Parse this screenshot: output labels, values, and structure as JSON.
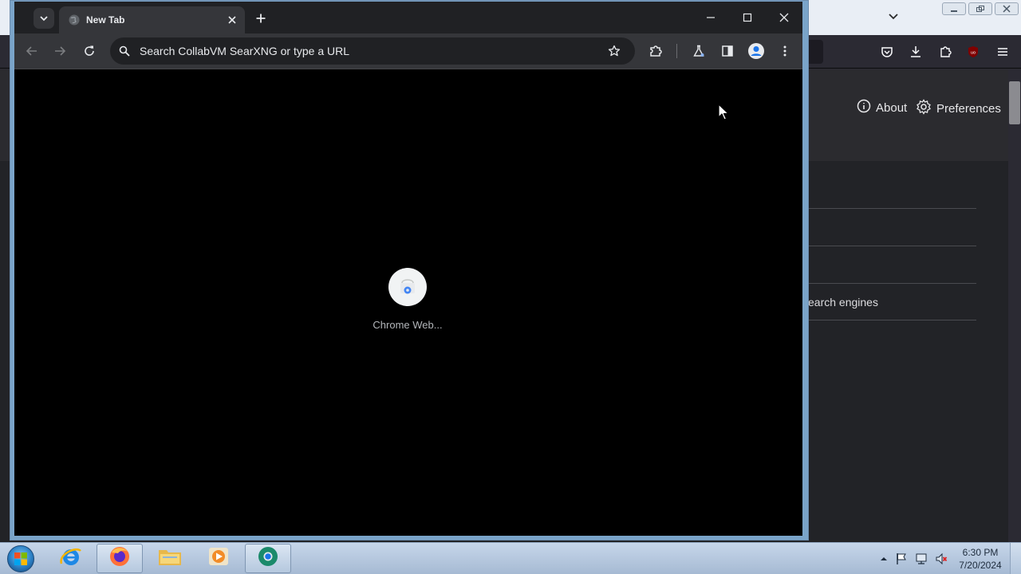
{
  "chrome": {
    "tab": {
      "title": "New Tab"
    },
    "omnibox": {
      "placeholder": "Search CollabVM SearXNG or type a URL"
    },
    "shortcuts": [
      {
        "label": "Chrome Web..."
      }
    ]
  },
  "firefox_background": {
    "header_links": {
      "about": "About",
      "preferences": "Preferences"
    },
    "list_text": "earch engines"
  },
  "taskbar": {
    "clock": {
      "time": "6:30 PM",
      "date": "7/20/2024"
    }
  },
  "colors": {
    "chrome_toolbar": "#35363a",
    "chrome_tabstrip": "#202124",
    "ntp_background": "#000000",
    "firefox_bg": "#2b2a33"
  }
}
